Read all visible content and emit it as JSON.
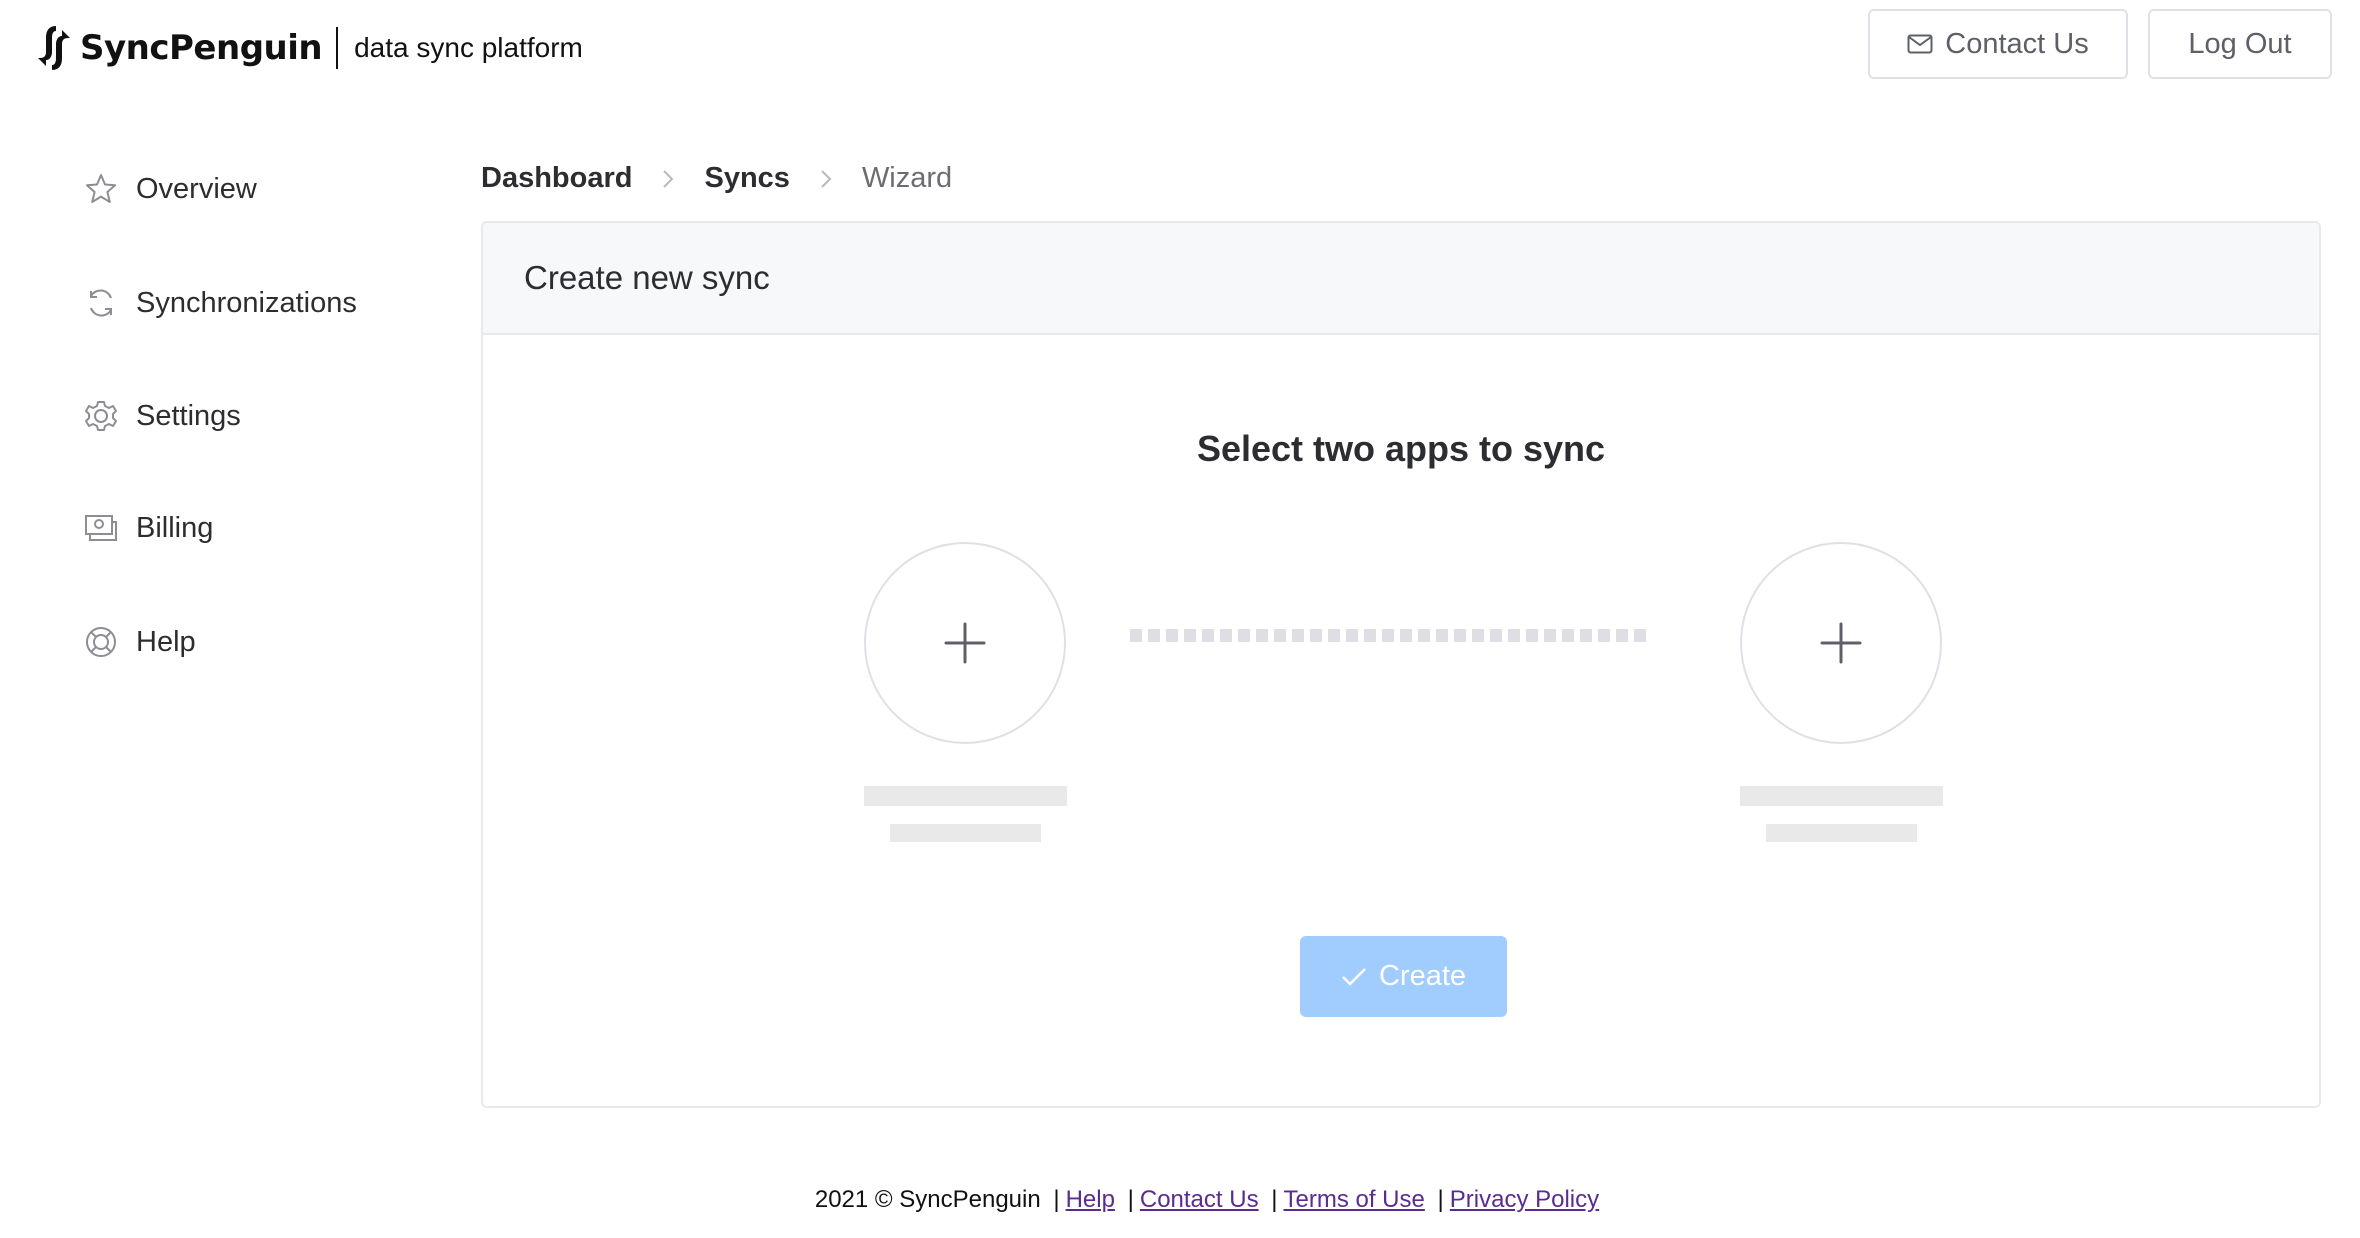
{
  "header": {
    "brand": "SyncPenguin",
    "tagline": "data sync platform",
    "contact_label": "Contact Us",
    "logout_label": "Log Out",
    "icons": {
      "logo": "sync-arrows-logo-icon",
      "contact": "mail-icon"
    }
  },
  "sidebar": {
    "items": [
      {
        "label": "Overview",
        "icon": "star-icon"
      },
      {
        "label": "Synchronizations",
        "icon": "sync-icon"
      },
      {
        "label": "Settings",
        "icon": "gear-icon"
      },
      {
        "label": "Billing",
        "icon": "billing-icon"
      },
      {
        "label": "Help",
        "icon": "lifebuoy-icon"
      }
    ]
  },
  "breadcrumb": {
    "items": [
      {
        "label": "Dashboard"
      },
      {
        "label": "Syncs"
      },
      {
        "label": "Wizard"
      }
    ],
    "separator_icon": "chevron-right-icon"
  },
  "card": {
    "title": "Create new sync",
    "heading": "Select two apps to sync",
    "slots": [
      {
        "icon": "plus-icon",
        "state": "empty"
      },
      {
        "icon": "plus-icon",
        "state": "empty"
      }
    ],
    "create_label": "Create",
    "create_icon": "check-icon",
    "create_enabled": false
  },
  "colors": {
    "create_button": "#a0cdfd",
    "link": "#5a2c91",
    "border": "#e6e9ef",
    "placeholder": "#e9e9e9"
  },
  "footer": {
    "copyright": "2021 © SyncPenguin",
    "links": [
      "Help",
      "Contact Us",
      "Terms of Use",
      "Privacy Policy"
    ],
    "separator": "|"
  }
}
